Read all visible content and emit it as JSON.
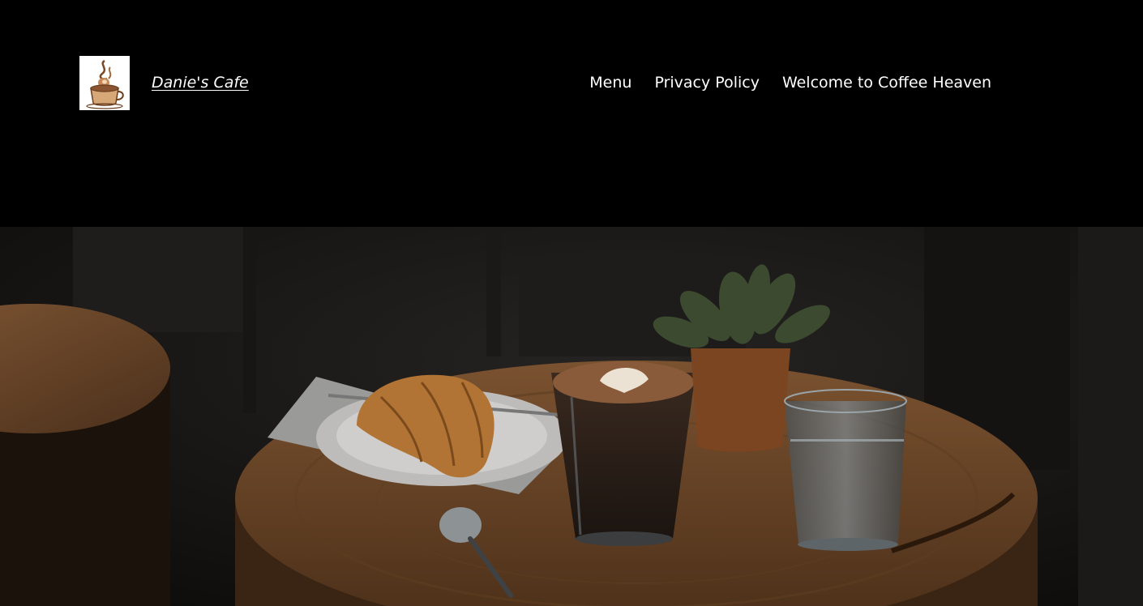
{
  "site": {
    "title": "Danie's Cafe",
    "logo_icon": "coffee-cup-logo-icon"
  },
  "nav": {
    "items": [
      {
        "label": "Menu"
      },
      {
        "label": "Privacy Policy"
      },
      {
        "label": "Welcome to Coffee Heaven"
      }
    ]
  },
  "hero": {
    "image": "cafe-table-photo",
    "subject": "croissant, latte with art, glass of water, potted plant on wooden table"
  },
  "colors": {
    "header_bg": "#000000",
    "text": "#ffffff",
    "wood": "#6b4526"
  }
}
